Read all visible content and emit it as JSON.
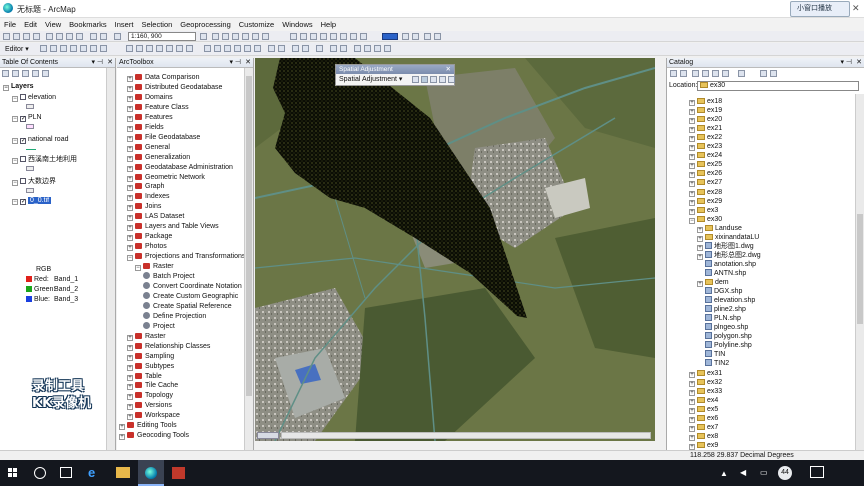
{
  "window": {
    "title": "无标题 - ArcMap",
    "float_badge": "小窗口播放"
  },
  "menu": [
    "File",
    "Edit",
    "View",
    "Bookmarks",
    "Insert",
    "Selection",
    "Geoprocessing",
    "Customize",
    "Windows",
    "Help"
  ],
  "toolbar": {
    "scale": "1:160, 900",
    "editor_label": "Editor ▾"
  },
  "toc": {
    "title": "Table Of Contents",
    "root": "Layers",
    "layers": [
      {
        "label": "elevation",
        "checked": false
      },
      {
        "label": "PLN",
        "checked": true
      },
      {
        "label": "national road",
        "checked": true
      },
      {
        "label": "西溪南土地利用",
        "checked": false
      },
      {
        "label": "大数边界",
        "checked": false
      },
      {
        "label": "0_0.tif",
        "checked": true
      }
    ],
    "rgb_label": "RGB",
    "bands": [
      {
        "label": "Red:",
        "value": "Band_1",
        "color": "#e0201a"
      },
      {
        "label": "Green:",
        "value": "Band_2",
        "color": "#1aa51a"
      },
      {
        "label": "Blue:",
        "value": "Band_3",
        "color": "#1a3fe0"
      }
    ]
  },
  "toolbox": {
    "title": "ArcToolbox",
    "items": [
      {
        "label": "Data Comparison",
        "level": 0
      },
      {
        "label": "Distributed Geodatabase",
        "level": 0
      },
      {
        "label": "Domains",
        "level": 0
      },
      {
        "label": "Feature Class",
        "level": 0
      },
      {
        "label": "Features",
        "level": 0
      },
      {
        "label": "Fields",
        "level": 0
      },
      {
        "label": "File Geodatabase",
        "level": 0
      },
      {
        "label": "General",
        "level": 0
      },
      {
        "label": "Generalization",
        "level": 0
      },
      {
        "label": "Geodatabase Administration",
        "level": 0
      },
      {
        "label": "Geometric Network",
        "level": 0
      },
      {
        "label": "Graph",
        "level": 0
      },
      {
        "label": "Indexes",
        "level": 0
      },
      {
        "label": "Joins",
        "level": 0
      },
      {
        "label": "LAS Dataset",
        "level": 0
      },
      {
        "label": "Layers and Table Views",
        "level": 0
      },
      {
        "label": "Package",
        "level": 0
      },
      {
        "label": "Photos",
        "level": 0
      },
      {
        "label": "Projections and Transformations",
        "level": 0
      },
      {
        "label": "Raster",
        "level": 1
      },
      {
        "label": "Batch Project",
        "level": 2
      },
      {
        "label": "Convert Coordinate Notation",
        "level": 2
      },
      {
        "label": "Create Custom Geographic",
        "level": 2
      },
      {
        "label": "Create Spatial Reference",
        "level": 2
      },
      {
        "label": "Define Projection",
        "level": 2
      },
      {
        "label": "Project",
        "level": 2
      },
      {
        "label": "Raster",
        "level": 0
      },
      {
        "label": "Relationship Classes",
        "level": 0
      },
      {
        "label": "Sampling",
        "level": 0
      },
      {
        "label": "Subtypes",
        "level": 0
      },
      {
        "label": "Table",
        "level": 0
      },
      {
        "label": "Tile Cache",
        "level": 0
      },
      {
        "label": "Topology",
        "level": 0
      },
      {
        "label": "Versions",
        "level": 0
      },
      {
        "label": "Workspace",
        "level": 0
      },
      {
        "label": "Editing Tools",
        "level": -1
      },
      {
        "label": "Geocoding Tools",
        "level": -1
      }
    ]
  },
  "spatial_adjustment": {
    "title": "Spatial Adjustment",
    "menu": "Spatial Adjustment ▾"
  },
  "catalog": {
    "title": "Catalog",
    "location_label": "Location:",
    "location_value": "ex30",
    "items": [
      {
        "label": "ex18",
        "type": "folder",
        "level": 0
      },
      {
        "label": "ex19",
        "type": "folder",
        "level": 0
      },
      {
        "label": "ex20",
        "type": "folder",
        "level": 0
      },
      {
        "label": "ex21",
        "type": "folder",
        "level": 0
      },
      {
        "label": "ex22",
        "type": "folder",
        "level": 0
      },
      {
        "label": "ex23",
        "type": "folder",
        "level": 0
      },
      {
        "label": "ex24",
        "type": "folder",
        "level": 0
      },
      {
        "label": "ex25",
        "type": "folder",
        "level": 0
      },
      {
        "label": "ex26",
        "type": "folder",
        "level": 0
      },
      {
        "label": "ex27",
        "type": "folder",
        "level": 0
      },
      {
        "label": "ex28",
        "type": "folder",
        "level": 0
      },
      {
        "label": "ex29",
        "type": "folder",
        "level": 0
      },
      {
        "label": "ex3",
        "type": "folder",
        "level": 0
      },
      {
        "label": "ex30",
        "type": "folder",
        "level": 0
      },
      {
        "label": "Landuse",
        "type": "folder",
        "level": 1
      },
      {
        "label": "xixinandataLU",
        "type": "folder",
        "level": 1
      },
      {
        "label": "地形图1.dwg",
        "type": "shp",
        "level": 1
      },
      {
        "label": "地形总图2.dwg",
        "type": "shp",
        "level": 1
      },
      {
        "label": "anotation.shp",
        "type": "shp",
        "level": 1
      },
      {
        "label": "ANTN.shp",
        "type": "shp",
        "level": 1
      },
      {
        "label": "dem",
        "type": "folder",
        "level": 1
      },
      {
        "label": "DGX.shp",
        "type": "shp",
        "level": 1
      },
      {
        "label": "elevation.shp",
        "type": "shp",
        "level": 1
      },
      {
        "label": "pline2.shp",
        "type": "shp",
        "level": 1
      },
      {
        "label": "PLN.shp",
        "type": "shp",
        "level": 1
      },
      {
        "label": "plngeo.shp",
        "type": "shp",
        "level": 1
      },
      {
        "label": "polygon.shp",
        "type": "shp",
        "level": 1
      },
      {
        "label": "Polyline.shp",
        "type": "shp",
        "level": 1
      },
      {
        "label": "TIN",
        "type": "shp",
        "level": 1
      },
      {
        "label": "TIN2",
        "type": "shp",
        "level": 1
      },
      {
        "label": "ex31",
        "type": "folder",
        "level": 0
      },
      {
        "label": "ex32",
        "type": "folder",
        "level": 0
      },
      {
        "label": "ex33",
        "type": "folder",
        "level": 0
      },
      {
        "label": "ex4",
        "type": "folder",
        "level": 0
      },
      {
        "label": "ex5",
        "type": "folder",
        "level": 0
      },
      {
        "label": "ex6",
        "type": "folder",
        "level": 0
      },
      {
        "label": "ex7",
        "type": "folder",
        "level": 0
      },
      {
        "label": "ex8",
        "type": "folder",
        "level": 0
      },
      {
        "label": "ex9",
        "type": "folder",
        "level": 0
      }
    ]
  },
  "status": {
    "coords": "118.258  29.837 Decimal Degrees"
  },
  "watermark": [
    "录制工具",
    "KK录像机"
  ],
  "taskbar": {
    "badge": "44"
  }
}
